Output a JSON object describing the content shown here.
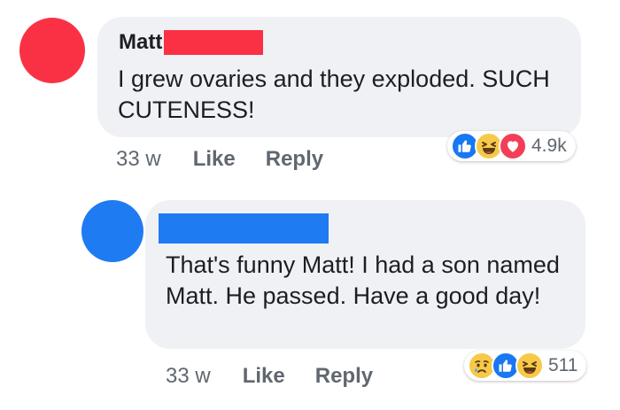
{
  "comments": [
    {
      "author": "Matt",
      "text": "I grew ovaries and they exploded. SUCH CUTENESS!",
      "time": "33 w",
      "like_label": "Like",
      "reply_label": "Reply",
      "reactions": [
        "like-icon",
        "haha-icon",
        "love-icon"
      ],
      "reaction_count": "4.9k",
      "avatar_color": "#fa3144",
      "redaction_color": "#fa3144"
    },
    {
      "author": "",
      "text": "That's funny Matt! I had a son named Matt. He passed. Have a good day!",
      "time": "33 w",
      "like_label": "Like",
      "reply_label": "Reply",
      "reactions": [
        "sad-icon",
        "like-icon",
        "haha-icon"
      ],
      "reaction_count": "511",
      "avatar_color": "#1e7bf2",
      "redaction_color": "#1e7bf2"
    }
  ],
  "colors": {
    "bubble": "#f0f1f4",
    "meta_text": "#606770",
    "like_blue": "#1877f2",
    "love_red": "#f33e58",
    "emoji_yellow": "#f7c94a"
  }
}
